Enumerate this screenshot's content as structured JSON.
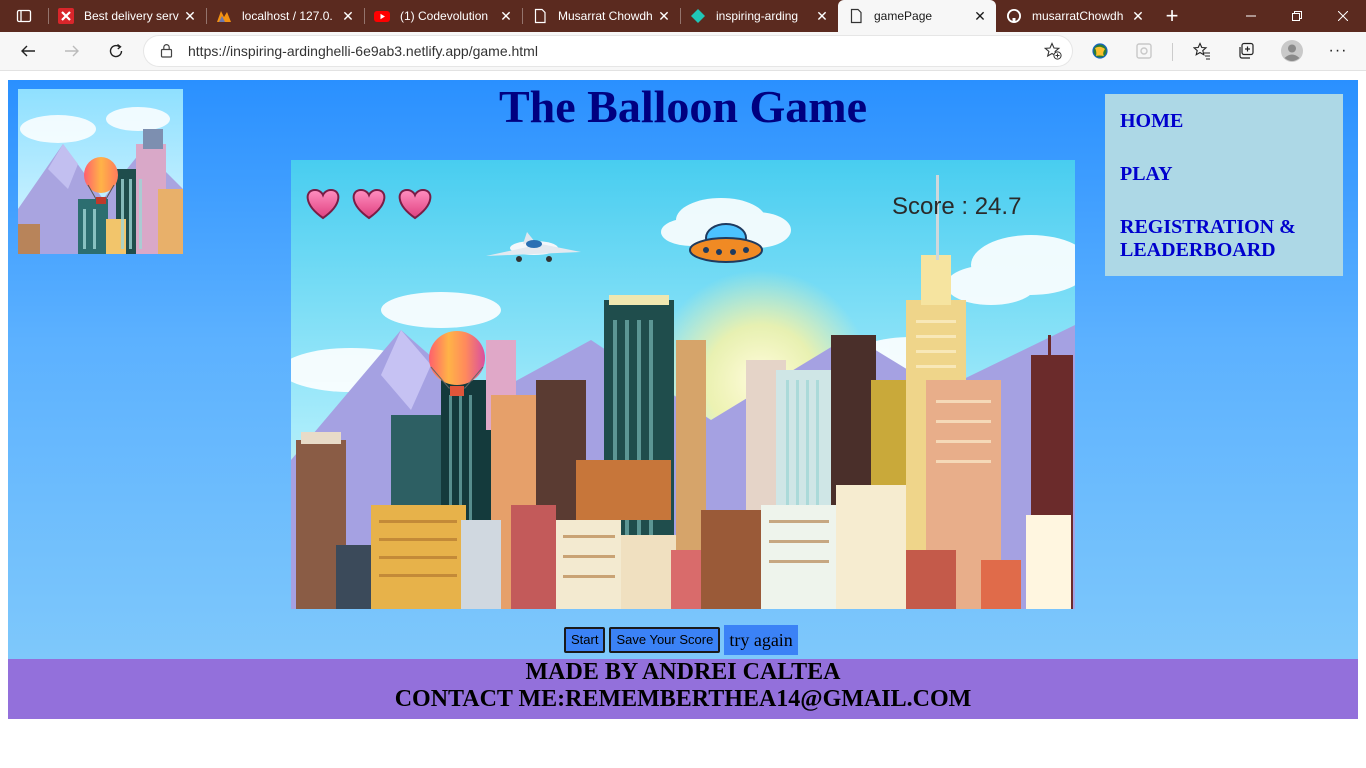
{
  "browser": {
    "tabs": [
      {
        "title": "Best delivery serv",
        "favicon": "red-x-favicon",
        "active": false
      },
      {
        "title": "localhost / 127.0.",
        "favicon": "phpmyadmin-favicon",
        "active": false
      },
      {
        "title": "(1) Codevolution",
        "favicon": "youtube-favicon",
        "active": false
      },
      {
        "title": "Musarrat Chowdh",
        "favicon": "page-favicon",
        "active": false
      },
      {
        "title": "inspiring-arding",
        "favicon": "netlify-favicon",
        "active": false
      },
      {
        "title": "gamePage",
        "favicon": "page-favicon",
        "active": true
      },
      {
        "title": "musarratChowdh",
        "favicon": "github-favicon",
        "active": false
      }
    ],
    "url": "https://inspiring-ardinghelli-6e9ab3.netlify.app/game.html"
  },
  "page": {
    "title": "The Balloon Game",
    "nav": {
      "home": "HOME",
      "play": "PLAY",
      "registration_line1": "REGISTRATION &",
      "registration_line2": "LEADERBOARD"
    },
    "game": {
      "lives": 3,
      "score_text": "Score : 24.7"
    },
    "buttons": {
      "start": "Start",
      "save": "Save Your Score",
      "try_again": "try again"
    },
    "footer": {
      "line1": "MADE BY ANDREI CALTEA",
      "line2": "CONTACT ME:REMEMBERTHEA14@GMAIL.COM"
    }
  },
  "colors": {
    "tab_bar": "#5b2a1f",
    "page_title": "#000080",
    "nav_bg": "#add8e6",
    "nav_link": "#0000cd",
    "footer_bg": "#9370db",
    "button_bg": "#3b82f6"
  }
}
